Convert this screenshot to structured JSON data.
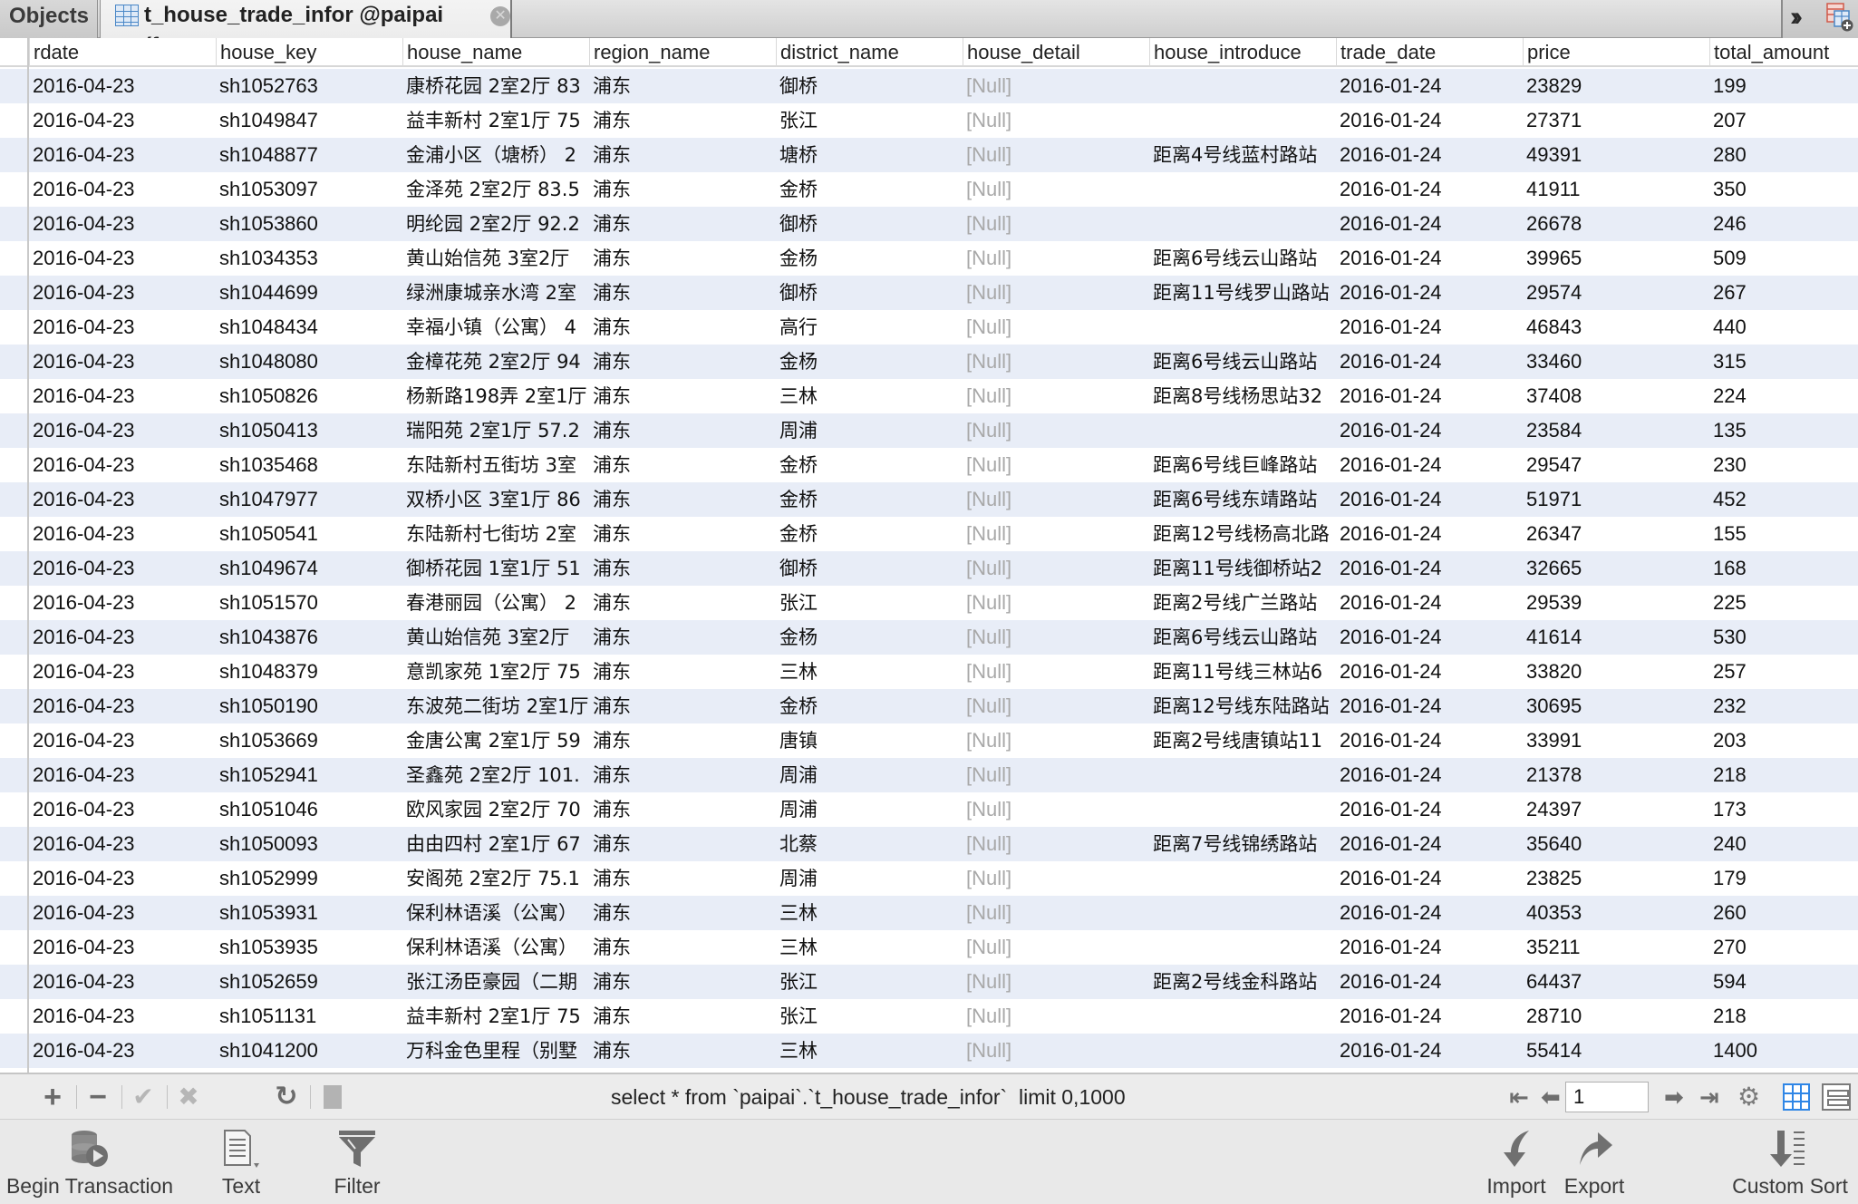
{
  "tabs": {
    "objects_label": "Objects",
    "active_label": "t_house_trade_infor @paipai (f...",
    "active_icon": "table-icon",
    "close_icon": "close-icon",
    "overflow_icon": "double-chevron-right-icon",
    "new_table_icon": "new-table-icon"
  },
  "grid": {
    "columns": [
      "rdate",
      "house_key",
      "house_name",
      "region_name",
      "district_name",
      "house_detail",
      "house_introduce",
      "trade_date",
      "price",
      "total_amount"
    ],
    "rows": [
      [
        "2016-04-23",
        "sh1052763",
        "康桥花园 2室2厅 83",
        "浦东",
        "御桥",
        "[Null]",
        "",
        "2016-01-24",
        "23829",
        "199"
      ],
      [
        "2016-04-23",
        "sh1049847",
        "益丰新村 2室1厅 75",
        "浦东",
        "张江",
        "[Null]",
        "",
        "2016-01-24",
        "27371",
        "207"
      ],
      [
        "2016-04-23",
        "sh1048877",
        "金浦小区（塘桥） 2",
        "浦东",
        "塘桥",
        "[Null]",
        "距离4号线蓝村路站",
        "2016-01-24",
        "49391",
        "280"
      ],
      [
        "2016-04-23",
        "sh1053097",
        "金泽苑 2室2厅 83.5",
        "浦东",
        "金桥",
        "[Null]",
        "",
        "2016-01-24",
        "41911",
        "350"
      ],
      [
        "2016-04-23",
        "sh1053860",
        "明纶园 2室2厅 92.2",
        "浦东",
        "御桥",
        "[Null]",
        "",
        "2016-01-24",
        "26678",
        "246"
      ],
      [
        "2016-04-23",
        "sh1034353",
        "黄山始信苑 3室2厅",
        "浦东",
        "金杨",
        "[Null]",
        "距离6号线云山路站",
        "2016-01-24",
        "39965",
        "509"
      ],
      [
        "2016-04-23",
        "sh1044699",
        "绿洲康城亲水湾 2室",
        "浦东",
        "御桥",
        "[Null]",
        "距离11号线罗山路站",
        "2016-01-24",
        "29574",
        "267"
      ],
      [
        "2016-04-23",
        "sh1048434",
        "幸福小镇（公寓） 4",
        "浦东",
        "高行",
        "[Null]",
        "",
        "2016-01-24",
        "46843",
        "440"
      ],
      [
        "2016-04-23",
        "sh1048080",
        "金樟花苑 2室2厅 94",
        "浦东",
        "金杨",
        "[Null]",
        "距离6号线云山路站",
        "2016-01-24",
        "33460",
        "315"
      ],
      [
        "2016-04-23",
        "sh1050826",
        "杨新路198弄 2室1厅",
        "浦东",
        "三林",
        "[Null]",
        "距离8号线杨思站32",
        "2016-01-24",
        "37408",
        "224"
      ],
      [
        "2016-04-23",
        "sh1050413",
        "瑞阳苑 2室1厅 57.2",
        "浦东",
        "周浦",
        "[Null]",
        "",
        "2016-01-24",
        "23584",
        "135"
      ],
      [
        "2016-04-23",
        "sh1035468",
        "东陆新村五街坊 3室",
        "浦东",
        "金桥",
        "[Null]",
        "距离6号线巨峰路站",
        "2016-01-24",
        "29547",
        "230"
      ],
      [
        "2016-04-23",
        "sh1047977",
        "双桥小区 3室1厅 86",
        "浦东",
        "金桥",
        "[Null]",
        "距离6号线东靖路站",
        "2016-01-24",
        "51971",
        "452"
      ],
      [
        "2016-04-23",
        "sh1050541",
        "东陆新村七街坊 2室",
        "浦东",
        "金桥",
        "[Null]",
        "距离12号线杨高北路",
        "2016-01-24",
        "26347",
        "155"
      ],
      [
        "2016-04-23",
        "sh1049674",
        "御桥花园 1室1厅 51",
        "浦东",
        "御桥",
        "[Null]",
        "距离11号线御桥站2",
        "2016-01-24",
        "32665",
        "168"
      ],
      [
        "2016-04-23",
        "sh1051570",
        "春港丽园（公寓） 2",
        "浦东",
        "张江",
        "[Null]",
        "距离2号线广兰路站",
        "2016-01-24",
        "29539",
        "225"
      ],
      [
        "2016-04-23",
        "sh1043876",
        "黄山始信苑 3室2厅",
        "浦东",
        "金杨",
        "[Null]",
        "距离6号线云山路站",
        "2016-01-24",
        "41614",
        "530"
      ],
      [
        "2016-04-23",
        "sh1048379",
        "意凯家苑 1室2厅 75",
        "浦东",
        "三林",
        "[Null]",
        "距离11号线三林站6",
        "2016-01-24",
        "33820",
        "257"
      ],
      [
        "2016-04-23",
        "sh1050190",
        "东波苑二街坊 2室1厅",
        "浦东",
        "金桥",
        "[Null]",
        "距离12号线东陆路站",
        "2016-01-24",
        "30695",
        "232"
      ],
      [
        "2016-04-23",
        "sh1053669",
        "金唐公寓 2室1厅 59",
        "浦东",
        "唐镇",
        "[Null]",
        "距离2号线唐镇站11",
        "2016-01-24",
        "33991",
        "203"
      ],
      [
        "2016-04-23",
        "sh1052941",
        "圣鑫苑 2室2厅 101.",
        "浦东",
        "周浦",
        "[Null]",
        "",
        "2016-01-24",
        "21378",
        "218"
      ],
      [
        "2016-04-23",
        "sh1051046",
        "欧风家园 2室2厅 70",
        "浦东",
        "周浦",
        "[Null]",
        "",
        "2016-01-24",
        "24397",
        "173"
      ],
      [
        "2016-04-23",
        "sh1050093",
        "由由四村 2室1厅 67",
        "浦东",
        "北蔡",
        "[Null]",
        "距离7号线锦绣路站",
        "2016-01-24",
        "35640",
        "240"
      ],
      [
        "2016-04-23",
        "sh1052999",
        "安阁苑 2室2厅 75.1",
        "浦东",
        "周浦",
        "[Null]",
        "",
        "2016-01-24",
        "23825",
        "179"
      ],
      [
        "2016-04-23",
        "sh1053931",
        "保利林语溪（公寓）",
        "浦东",
        "三林",
        "[Null]",
        "",
        "2016-01-24",
        "40353",
        "260"
      ],
      [
        "2016-04-23",
        "sh1053935",
        "保利林语溪（公寓）",
        "浦东",
        "三林",
        "[Null]",
        "",
        "2016-01-24",
        "35211",
        "270"
      ],
      [
        "2016-04-23",
        "sh1052659",
        "张江汤臣豪园（二期",
        "浦东",
        "张江",
        "[Null]",
        "距离2号线金科路站",
        "2016-01-24",
        "64437",
        "594"
      ],
      [
        "2016-04-23",
        "sh1051131",
        "益丰新村 2室1厅 75",
        "浦东",
        "张江",
        "[Null]",
        "",
        "2016-01-24",
        "28710",
        "218"
      ],
      [
        "2016-04-23",
        "sh1041200",
        "万科金色里程（别墅",
        "浦东",
        "三林",
        "[Null]",
        "",
        "2016-01-24",
        "55414",
        "1400"
      ]
    ]
  },
  "toolbar": {
    "add_icon": "plus-icon",
    "delete_icon": "minus-icon",
    "apply_icon": "checkmark-icon",
    "discard_icon": "x-icon",
    "refresh_icon": "refresh-icon",
    "stop_icon": "stop-icon",
    "sql": "select * from `paipai`.`t_house_trade_infor`  limit 0,1000",
    "page_value": "1",
    "first_page_icon": "first-page-icon",
    "prev_page_icon": "prev-page-icon",
    "next_page_icon": "next-page-icon",
    "last_page_icon": "last-page-icon",
    "settings_icon": "gear-icon",
    "grid_view_icon": "grid-view-icon",
    "form_view_icon": "form-view-icon"
  },
  "actions": {
    "begin_transaction": "Begin Transaction",
    "text": "Text",
    "filter": "Filter",
    "import": "Import",
    "export": "Export",
    "custom_sort": "Custom Sort"
  },
  "colors": {
    "row_alt": "#e8edf7",
    "null_text": "#a8a8a8",
    "accent": "#2f86e6"
  }
}
